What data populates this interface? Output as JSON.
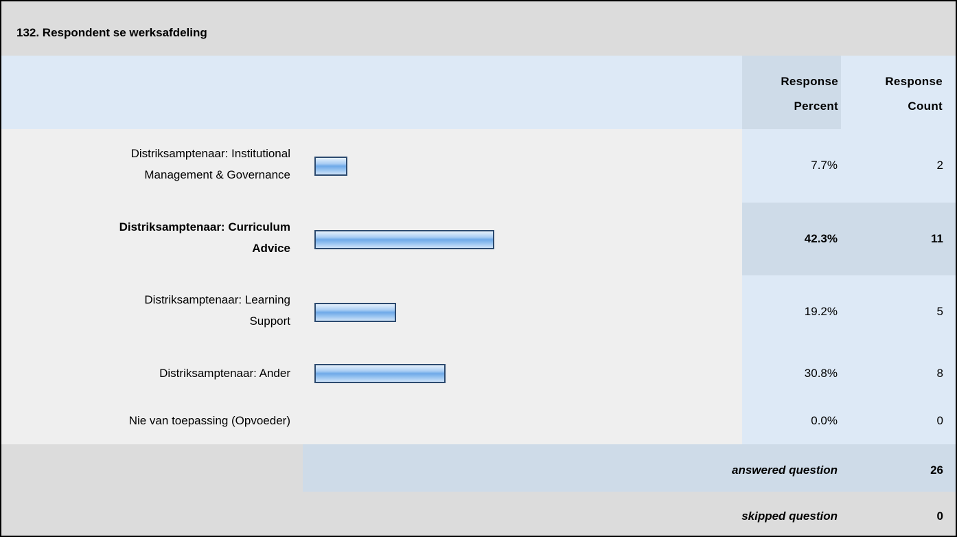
{
  "question_title": "132. Respondent se werksafdeling",
  "headers": {
    "percent_line1": "Response",
    "percent_line2": "Percent",
    "count_line1": "Response",
    "count_line2": "Count"
  },
  "rows": [
    {
      "label_line1": "Distriksamptenaar: Institutional",
      "label_line2": "Management & Governance",
      "percent": "7.7%",
      "count": "2"
    },
    {
      "label_line1": "Distriksamptenaar: Curriculum",
      "label_line2": "Advice",
      "percent": "42.3%",
      "count": "11"
    },
    {
      "label_line1": "Distriksamptenaar: Learning",
      "label_line2": "Support",
      "percent": "19.2%",
      "count": "5"
    },
    {
      "label_line1": "Distriksamptenaar: Ander",
      "label_line2": "",
      "percent": "30.8%",
      "count": "8"
    },
    {
      "label_line1": "Nie van toepassing (Opvoeder)",
      "label_line2": "",
      "percent": "0.0%",
      "count": "0"
    }
  ],
  "footer": {
    "answered_label": "answered question",
    "answered_value": "26",
    "skipped_label": "skipped question",
    "skipped_value": "0"
  },
  "chart_data": {
    "type": "bar",
    "orientation": "horizontal",
    "title": "132. Respondent se werksafdeling",
    "categories": [
      "Distriksamptenaar: Institutional Management & Governance",
      "Distriksamptenaar: Curriculum Advice",
      "Distriksamptenaar: Learning Support",
      "Distriksamptenaar: Ander",
      "Nie van toepassing (Opvoeder)"
    ],
    "values": [
      7.7,
      42.3,
      19.2,
      30.8,
      0.0
    ],
    "counts": [
      2,
      11,
      5,
      8,
      0
    ],
    "highlighted_index": 1,
    "bar_color": "#8ebdee",
    "bar_border": "#2c4a6f"
  }
}
